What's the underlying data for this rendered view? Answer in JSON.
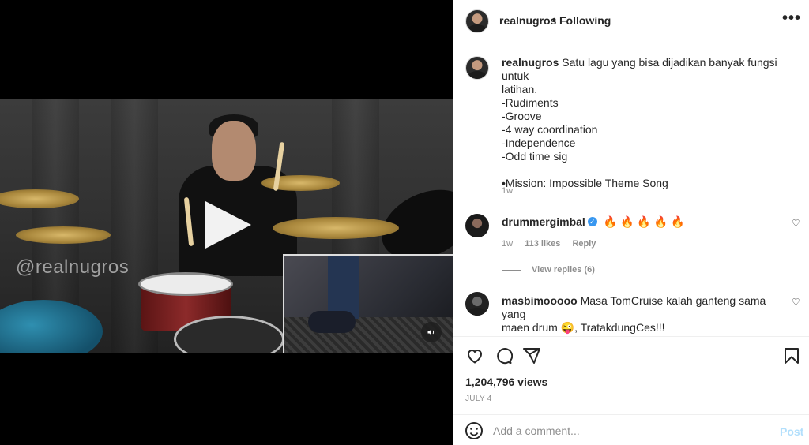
{
  "video": {
    "watermark": "@realnugros",
    "play_icon": "play-icon",
    "mute_icon": "speaker-icon"
  },
  "header": {
    "username": "realnugros",
    "separator": "•",
    "follow_label": "Following",
    "more_label": "•••"
  },
  "caption": {
    "username": "realnugros",
    "lines": [
      "Satu lagu yang bisa dijadikan banyak fungsi untuk",
      "latihan.",
      "-Rudiments",
      "-Groove",
      "-4 way coordination",
      "-Independence",
      "-Odd time sig",
      "",
      "•Mission: Impossible Theme Song"
    ],
    "time": "1w"
  },
  "comments": [
    {
      "username": "drummergimbal",
      "verified": true,
      "text": "🔥 🔥 🔥 🔥 🔥",
      "time": "1w",
      "likes": "113 likes",
      "reply_label": "Reply",
      "view_replies": "View replies (6)"
    },
    {
      "username": "masbimooooo",
      "text_line1": "Masa TomCruise kalah ganteng sama yang",
      "text_line2": "maen drum 😜, TratakdungCes!!!"
    }
  ],
  "actions": {
    "like_icon": "heart-icon",
    "comment_icon": "comment-icon",
    "share_icon": "share-icon",
    "save_icon": "bookmark-icon"
  },
  "views": "1,204,796 views",
  "date": "JULY 4",
  "add_comment": {
    "placeholder": "Add a comment...",
    "post_label": "Post"
  },
  "colors": {
    "accent": "#0095f6",
    "post_disabled": "#b2dffc",
    "verified": "#3897f0",
    "text": "#262626",
    "muted": "#8e8e8e"
  }
}
